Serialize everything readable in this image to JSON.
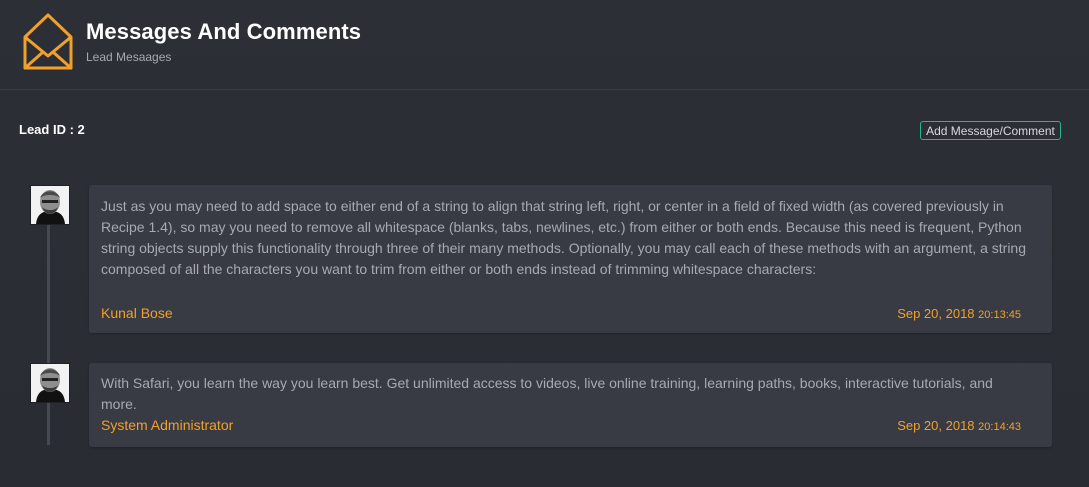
{
  "header": {
    "title": "Messages And Comments",
    "subtitle": "Lead Mesaages",
    "icon": "envelope-icon",
    "icon_color": "#f0a12c"
  },
  "lead": {
    "id_label": "Lead ID : 2"
  },
  "actions": {
    "add_label": "Add Message/Comment",
    "add_border_color": "#27b688"
  },
  "messages": [
    {
      "text": "Just as you may need to add space to either end of a string to align that string left, right, or center in a field of fixed width (as covered previously in Recipe 1.4), so may you need to remove all whitespace (blanks, tabs, newlines, etc.) from either or both ends. Because this need is frequent, Python string objects supply this functionality through three of their many methods. Optionally, you may call each of these methods with an argument, a string composed of all the characters you want to trim from either or both ends instead of trimming whitespace characters:",
      "author": "Kunal Bose",
      "date": "Sep 20, 2018",
      "time": "20:13:45"
    },
    {
      "text": "With Safari, you learn the way you learn best. Get unlimited access to videos, live online training, learning paths, books, interactive tutorials, and more.",
      "author": "System Administrator",
      "date": "Sep 20, 2018",
      "time": "20:14:43"
    }
  ],
  "colors": {
    "background": "#2b2d35",
    "card": "#383a44",
    "accent": "#f0a12c",
    "text": "#a8aab1"
  }
}
